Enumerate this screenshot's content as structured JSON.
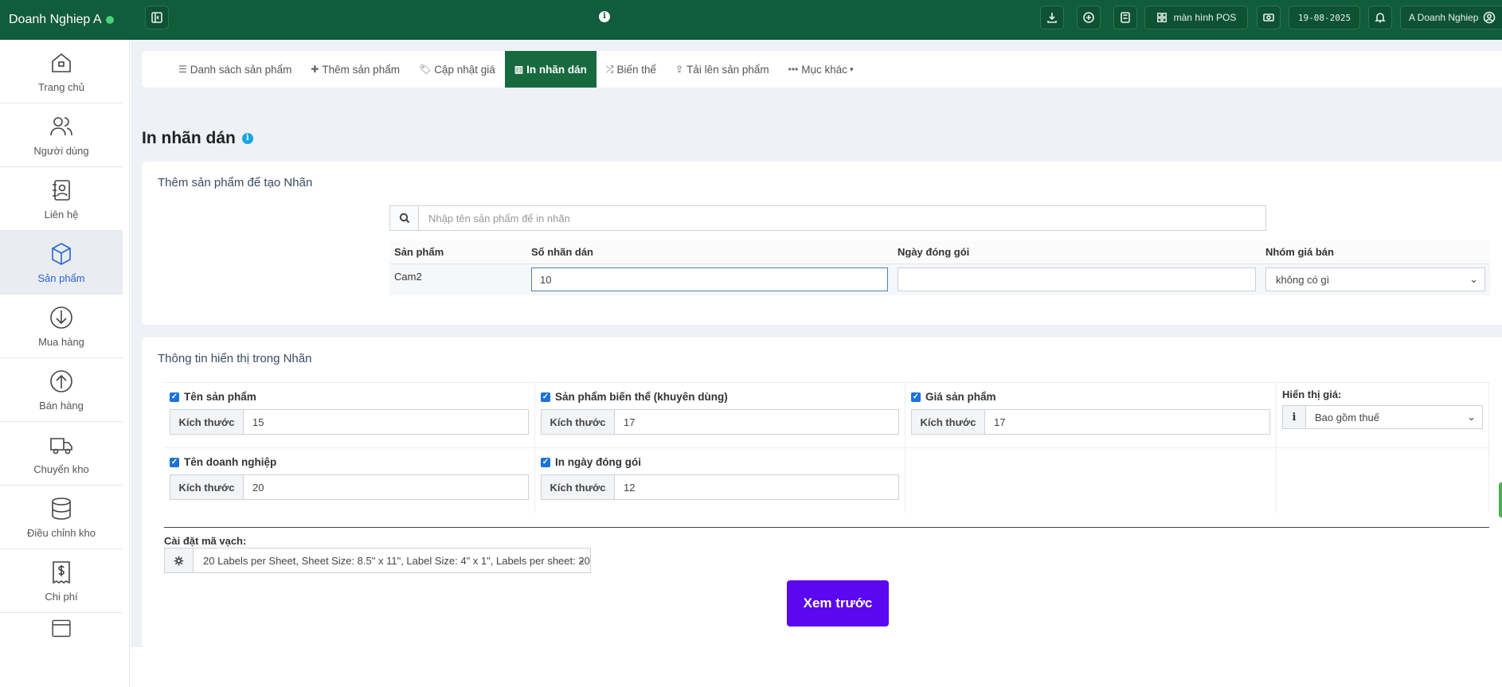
{
  "topbar": {
    "brand": "Doanh Nghiep A",
    "pos_label": "màn hình POS",
    "date": "19-08-2025",
    "user": "A Doanh Nghiep"
  },
  "sidebar": {
    "items": [
      {
        "label": "Trang chủ",
        "icon": "home-icon"
      },
      {
        "label": "Người dùng",
        "icon": "users-icon"
      },
      {
        "label": "Liên hệ",
        "icon": "contacts-icon"
      },
      {
        "label": "Sản phẩm",
        "icon": "box-icon",
        "active": true
      },
      {
        "label": "Mua hàng",
        "icon": "download-icon"
      },
      {
        "label": "Bán hàng",
        "icon": "upload-icon"
      },
      {
        "label": "Chuyển kho",
        "icon": "truck-icon"
      },
      {
        "label": "Điều chỉnh kho",
        "icon": "database-icon"
      },
      {
        "label": "Chi phí",
        "icon": "receipt-icon"
      }
    ]
  },
  "tabs": [
    {
      "label": "Danh sách sản phẩm",
      "icon": "list-icon"
    },
    {
      "label": "Thêm sản phẩm",
      "icon": "plus-icon"
    },
    {
      "label": "Cập nhật giá",
      "icon": "tag-icon"
    },
    {
      "label": "In nhãn dán",
      "icon": "barcode-icon",
      "active": true
    },
    {
      "label": "Biến thể",
      "icon": "shuffle-icon"
    },
    {
      "label": "Tải lên sản phẩm",
      "icon": "upload-icon"
    },
    {
      "label": "Mục khác",
      "icon": "more-icon"
    }
  ],
  "page": {
    "title": "In nhãn dán"
  },
  "add_card": {
    "title": "Thêm sản phẩm để tạo Nhãn",
    "search_placeholder": "Nhập tên sản phẩm để in nhãn",
    "headers": [
      "Sản phẩm",
      "Số nhãn dán",
      "Ngày đóng gói",
      "Nhóm giá bán"
    ],
    "row": {
      "product": "Cam2",
      "count": "10",
      "pack_date": "",
      "price_group": "không có gì"
    }
  },
  "display_card": {
    "title": "Thông tin hiển thị trong Nhãn",
    "size_label": "Kích thước",
    "product_name": {
      "label": "Tên sản phẩm",
      "size": "15",
      "checked": true
    },
    "variant": {
      "label": "Sản phẩm biến thể (khuyên dùng)",
      "size": "17",
      "checked": true
    },
    "price": {
      "label": "Giá sản phẩm",
      "size": "17",
      "checked": true
    },
    "show_price": {
      "label": "Hiển thị giá:",
      "value": "Bao gồm thuế"
    },
    "business_name": {
      "label": "Tên doanh nghiệp",
      "size": "20",
      "checked": true
    },
    "pack_date": {
      "label": "In ngày đóng gói",
      "size": "12",
      "checked": true
    },
    "barcode_label": "Cài đặt mã vạch:",
    "barcode_value": "20 Labels per Sheet, Sheet Size: 8.5\" x 11\", Label Size: 4\" x 1\", Labels per sheet: 20",
    "preview_button": "Xem trước"
  },
  "colors": {
    "topbar": "#115c3b",
    "active_tab": "#17693e",
    "primary": "#5b07ef",
    "sidebar_active": "#2862d6"
  }
}
